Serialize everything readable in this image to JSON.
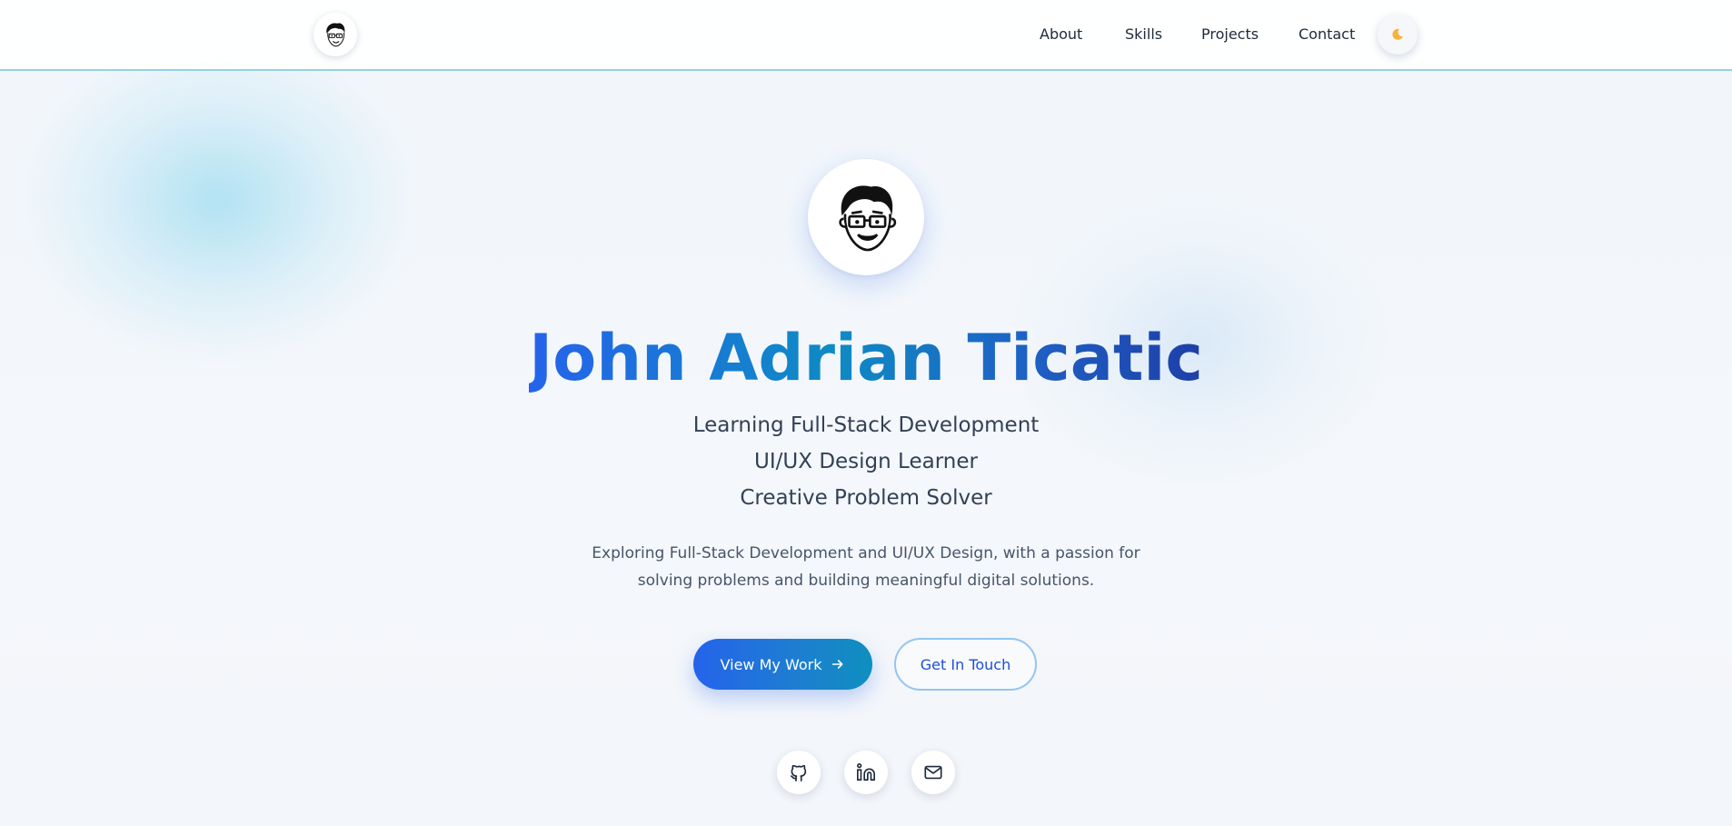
{
  "nav": {
    "logo_icon": "cartoon-avatar-icon",
    "links": [
      {
        "label": "About"
      },
      {
        "label": "Skills"
      },
      {
        "label": "Projects"
      },
      {
        "label": "Contact"
      }
    ],
    "theme_toggle_icon": "moon-icon"
  },
  "hero": {
    "avatar_icon": "cartoon-avatar-icon",
    "name": "John Adrian Ticatic",
    "roles": [
      "Learning Full-Stack Development",
      "UI/UX Design Learner",
      "Creative Problem Solver"
    ],
    "intro": "Exploring Full-Stack Development and UI/UX Design, with a passion for solving problems and building meaningful digital solutions.",
    "primary_button": {
      "label": "View My Work",
      "icon": "arrow-right-icon"
    },
    "secondary_button": {
      "label": "Get In Touch"
    },
    "socials": [
      {
        "icon": "github-icon"
      },
      {
        "icon": "linkedin-icon"
      },
      {
        "icon": "mail-icon"
      }
    ]
  },
  "colors": {
    "accent_blue": "#2563eb",
    "accent_teal": "#0e8bc4",
    "nav_border": "#8fd3e6",
    "text_dark": "#1e2a3b",
    "text_muted": "#475569"
  }
}
